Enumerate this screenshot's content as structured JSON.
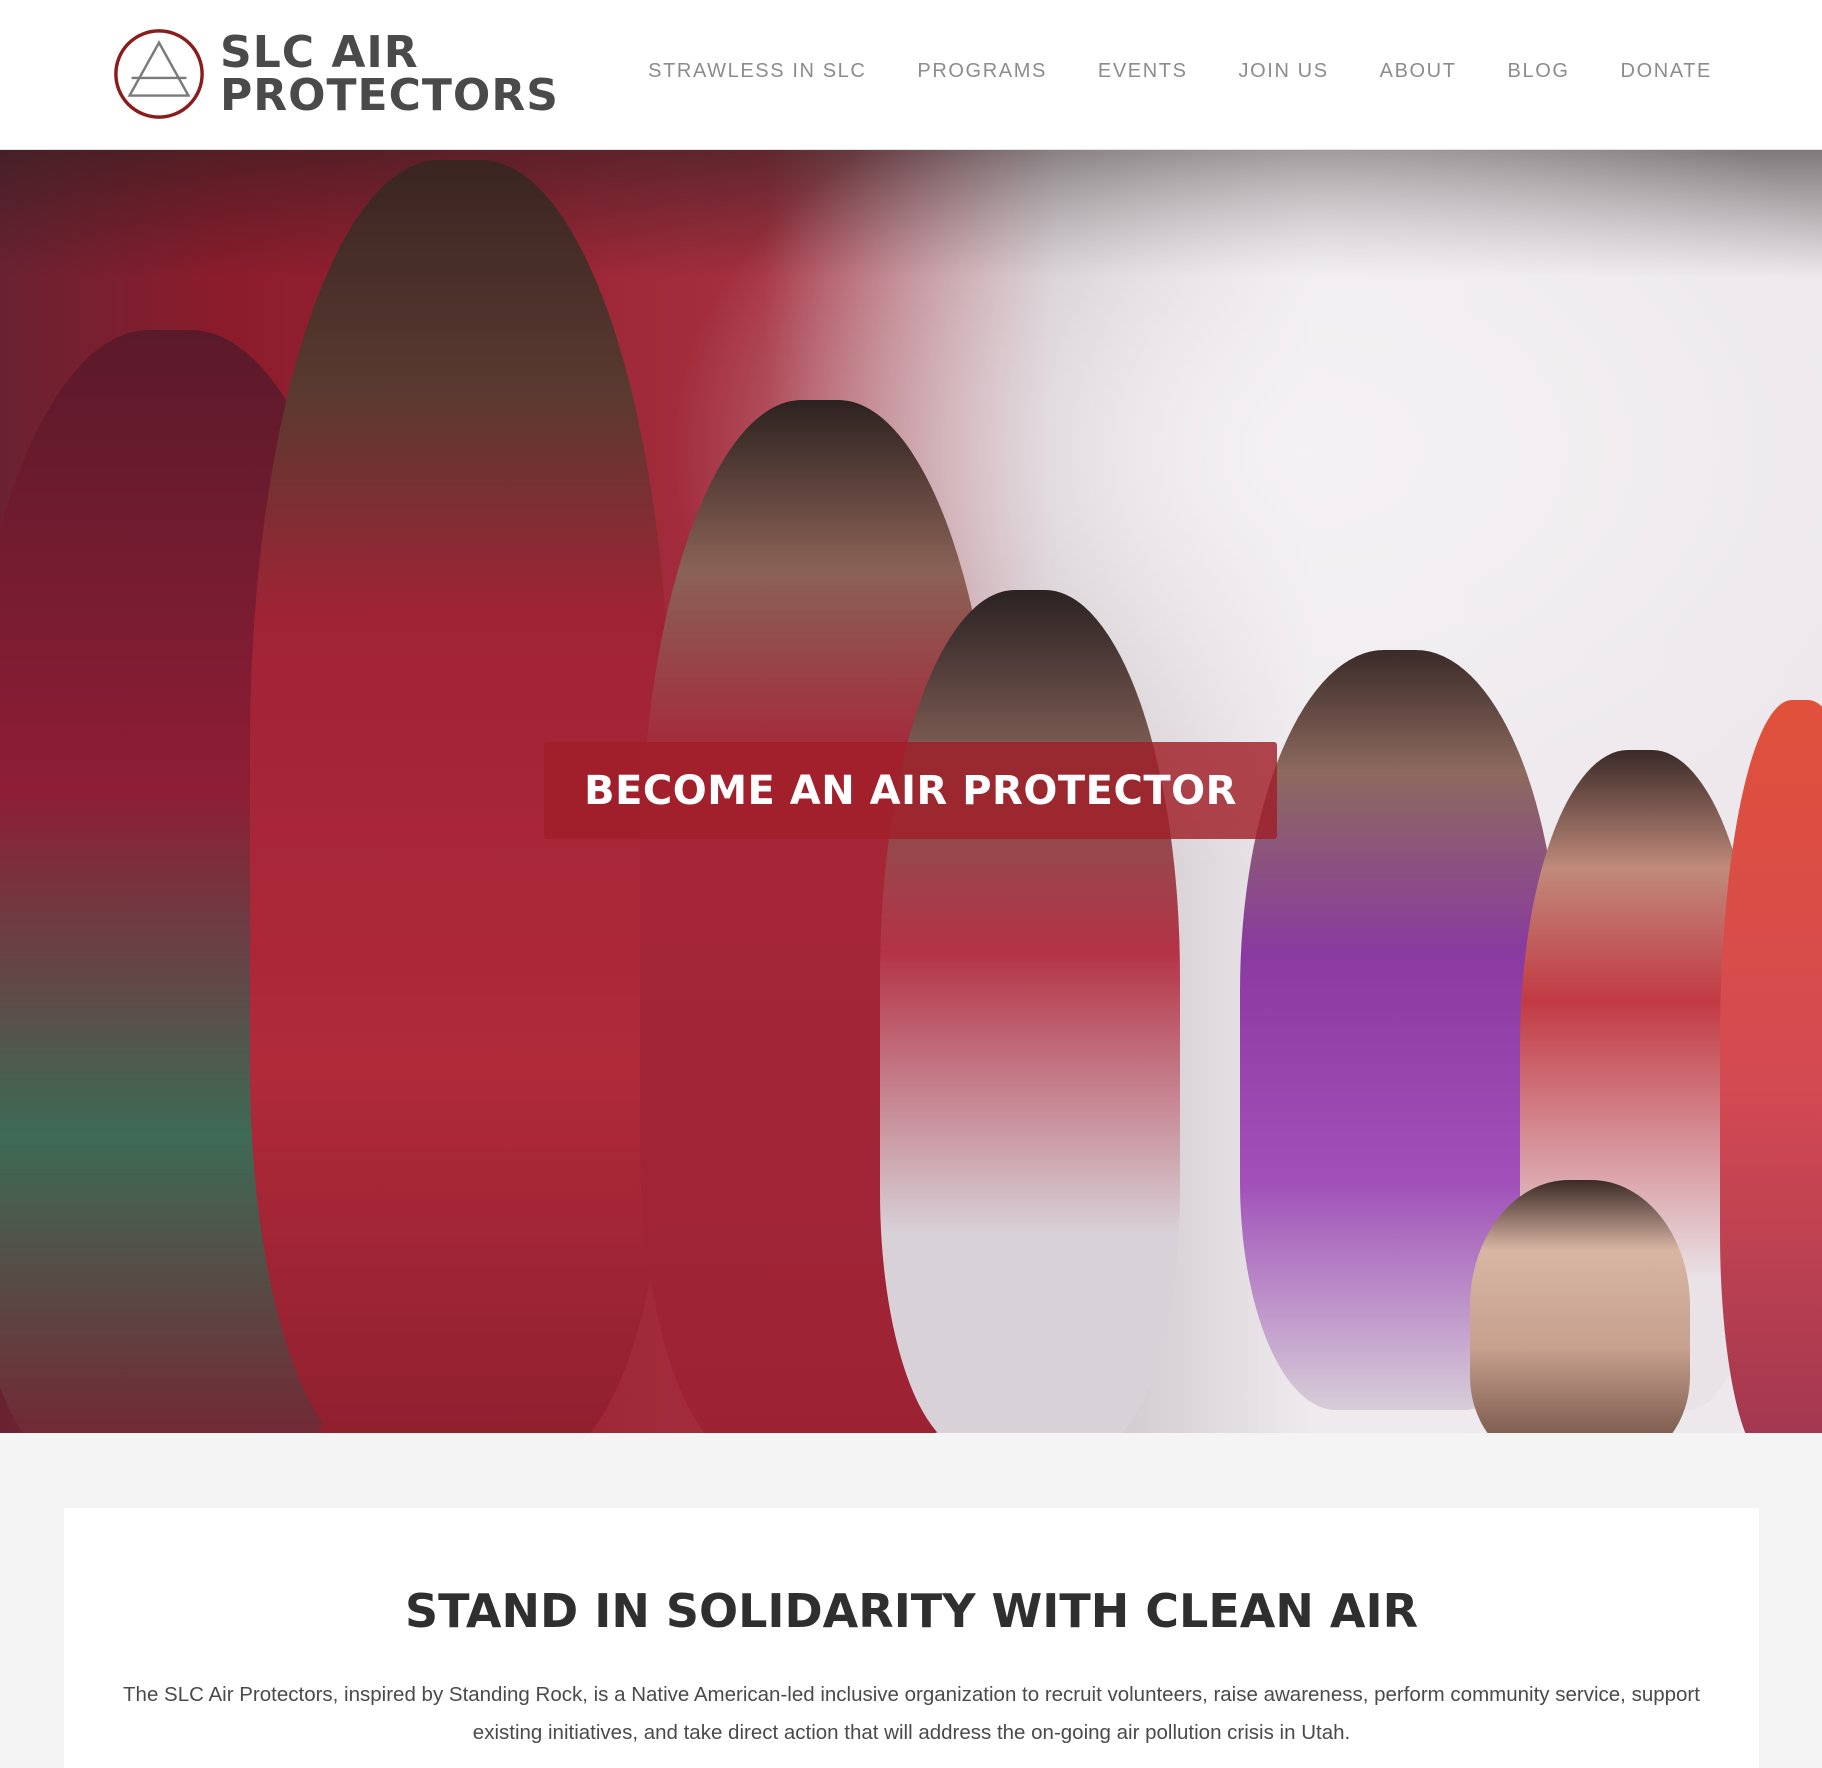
{
  "brand": {
    "line1": "SLC AIR",
    "line2": "PROTECTORS",
    "logo_icon": "triangle-in-circle-icon",
    "accent_color": "#8b1c1c"
  },
  "nav": {
    "items": [
      {
        "label": "STRAWLESS IN SLC"
      },
      {
        "label": "PROGRAMS"
      },
      {
        "label": "EVENTS"
      },
      {
        "label": "JOIN US"
      },
      {
        "label": "ABOUT"
      },
      {
        "label": "BLOG"
      },
      {
        "label": "DONATE"
      }
    ]
  },
  "hero": {
    "cta_label": "BECOME AN AIR PROTECTOR",
    "cta_color": "#a01e28"
  },
  "main": {
    "title": "STAND IN SOLIDARITY WITH CLEAN AIR",
    "body": "The SLC Air Protectors, inspired by Standing Rock, is a Native American-led inclusive organization to recruit volunteers, raise awareness, perform community service, support existing initiatives, and take direct action that will address the on-going air pollution crisis in Utah."
  }
}
